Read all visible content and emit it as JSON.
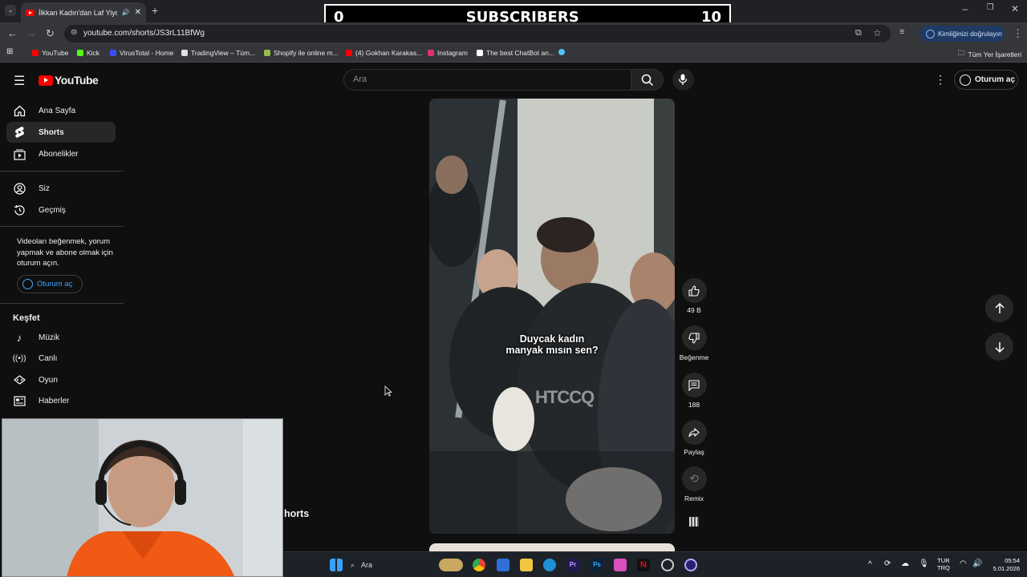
{
  "browser": {
    "tab_title": "İlkkan Kadın'dan Laf Yiyor #",
    "url": "youtube.com/shorts/JS3rL11BfWg",
    "verify_label": "Kimliğinizi doğrulayın",
    "bookmarks": [
      "YouTube",
      "Kick",
      "VirusTotal - Home",
      "TradingView – Tüm...",
      "Shopify ile online m...",
      "(4) Gokhan Karakas...",
      "Instagram",
      "The best ChatBot an..."
    ],
    "all_bookmarks": "Tüm Yer İşaretleri"
  },
  "overlay": {
    "left": "0",
    "label": "SUBSCRIBERS",
    "right": "10"
  },
  "youtube": {
    "logo": "YouTube",
    "search_placeholder": "Ara",
    "signin_top": "Oturum aç",
    "sidebar": {
      "home": "Ana Sayfa",
      "shorts": "Shorts",
      "subs": "Abonelikler",
      "you": "Siz",
      "history": "Geçmiş",
      "prompt": "Videoları beğenmek, yorum yapmak ve abone olmak için oturum açın.",
      "signin": "Oturum aç",
      "explore": "Keşfet",
      "music": "Müzik",
      "live": "Canlı",
      "gaming": "Oyun",
      "news": "Haberler",
      "shorts_partial": "horts"
    },
    "video": {
      "caption_1": "Duycak kadın",
      "caption_2": "manyak mısın sen?",
      "watermark": "HTCCQ"
    },
    "actions": {
      "likes": "49 B",
      "dislike": "Beğenme",
      "comments": "188",
      "share": "Paylaş",
      "remix": "Remix"
    }
  },
  "taskbar": {
    "search": "Ara",
    "lang_1": "TUR",
    "lang_2": "TRQ",
    "time": "05:54",
    "date": "5.01.2026"
  },
  "colors": {
    "yt_red": "#ff0000",
    "bg": "#0f0f0f",
    "link_blue": "#3ea6ff"
  }
}
